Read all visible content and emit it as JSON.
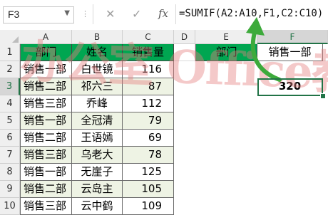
{
  "formula_bar": {
    "name_box": "F3",
    "cancel_glyph": "✕",
    "enter_glyph": "✓",
    "fx_label": "fx",
    "formula": "=SUMIF(A2:A10,F1,C2:C10)"
  },
  "columns": [
    "A",
    "B",
    "C",
    "D",
    "E",
    "F"
  ],
  "rows": [
    "1",
    "2",
    "3",
    "4",
    "5",
    "6",
    "7",
    "8",
    "9",
    "10"
  ],
  "table": {
    "headers": [
      "部门",
      "姓名",
      "销售量"
    ],
    "records": [
      {
        "dept": "销售一部",
        "name": "白世镜",
        "qty": "116"
      },
      {
        "dept": "销售二部",
        "name": "祁六三",
        "qty": "87"
      },
      {
        "dept": "销售三部",
        "name": "乔峰",
        "qty": "112"
      },
      {
        "dept": "销售一部",
        "name": "全冠清",
        "qty": "79"
      },
      {
        "dept": "销售二部",
        "name": "王语嫣",
        "qty": "69"
      },
      {
        "dept": "销售三部",
        "name": "乌老大",
        "qty": "78"
      },
      {
        "dept": "销售一部",
        "name": "无崖子",
        "qty": "125"
      },
      {
        "dept": "销售二部",
        "name": "云岛主",
        "qty": "105"
      },
      {
        "dept": "销售三部",
        "name": "云中鹤",
        "qty": "109"
      }
    ]
  },
  "lookup": {
    "e1_label": "部门",
    "f1_value": "销售一部",
    "f3_result": "320"
  },
  "watermark": "办公室 Office教程网",
  "colors": {
    "header_fill": "#00a651",
    "band_fill": "#eef3e4",
    "selection": "#217346",
    "arrow": "#3daa3b"
  }
}
